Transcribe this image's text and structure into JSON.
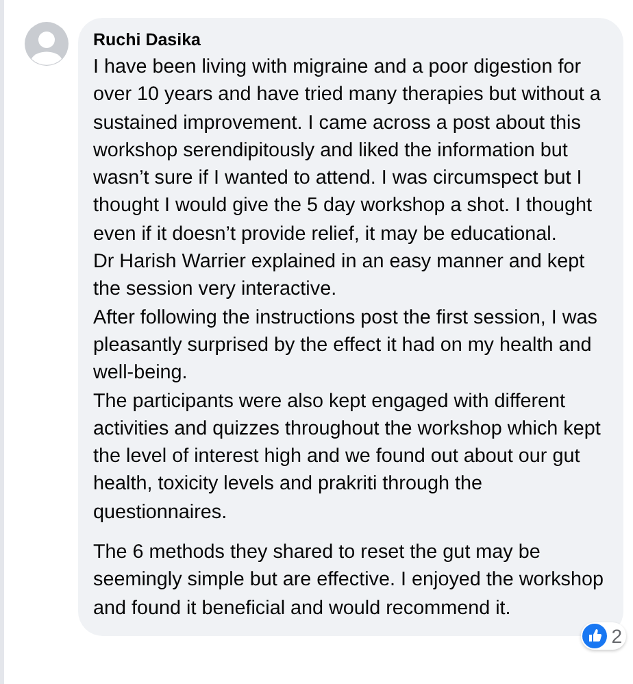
{
  "comment": {
    "author": "Ruchi Dasika",
    "paragraph_groups": [
      [
        "I have been living with migraine and a poor digestion for over 10 years and have tried many therapies but without a sustained improvement. I came across a post about this workshop serendipitously and liked the information but wasn’t sure if I wanted to attend. I was circumspect but I thought I would give the 5 day workshop a shot. I thought even if it doesn’t provide relief, it may be educational.",
        "Dr Harish Warrier explained in an easy manner and kept the session very interactive.",
        "After following the instructions post the first session, I was pleasantly surprised by the effect it had on my health and well-being.",
        "The participants were also kept engaged with different activities and quizzes throughout the workshop which kept the level of interest high and we found out about our gut health, toxicity levels and prakriti through the questionnaires."
      ],
      [
        "The 6 methods they shared to reset the gut may be seemingly simple but are effective. I enjoyed the workshop and found it beneficial and would recommend it."
      ]
    ],
    "reaction_count": "2"
  }
}
